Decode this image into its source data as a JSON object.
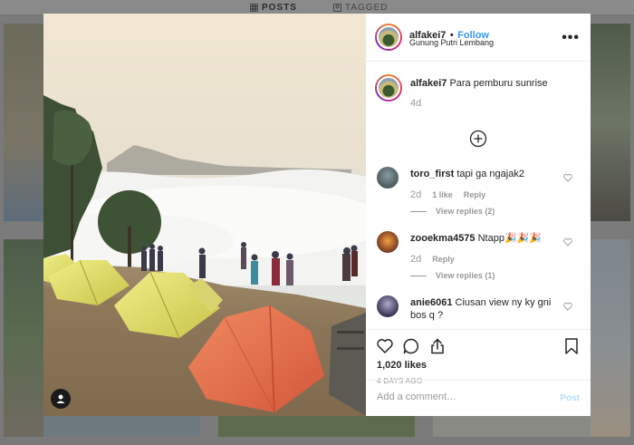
{
  "profile_tabs": {
    "posts": "POSTS",
    "tagged": "TAGGED"
  },
  "post": {
    "username": "alfakei7",
    "separator": "•",
    "follow_label": "Follow",
    "location": "Gunung Putri Lembang",
    "more_label": "•••",
    "caption_user": "alfakei7",
    "caption_text": "Para pemburu sunrise",
    "caption_age": "4d",
    "likes": "1,020 likes",
    "date": "4 DAYS AGO",
    "comment_placeholder": "Add a comment…",
    "post_button": "Post"
  },
  "comments": [
    {
      "user": "toro_first",
      "text": "tapi ga ngajak2",
      "age": "2d",
      "likes": "1 like",
      "reply": "Reply",
      "view_replies": "View replies (2)"
    },
    {
      "user": "zooekma4575",
      "text": "Ntapp🎉🎉🎉",
      "age": "2d",
      "likes": "",
      "reply": "Reply",
      "view_replies": "View replies (1)"
    },
    {
      "user": "anie6061",
      "text": "Ciusan view ny ky gni bos q ?"
    }
  ],
  "icons": {
    "like": "heart-icon",
    "comment": "comment-icon",
    "share": "share-icon",
    "save": "bookmark-icon",
    "load_more": "plus-circle-icon",
    "tag": "user-tag-icon"
  },
  "colors": {
    "follow": "#3897f0",
    "post_disabled": "#b2dffc",
    "muted": "#999999",
    "text": "#262626"
  }
}
